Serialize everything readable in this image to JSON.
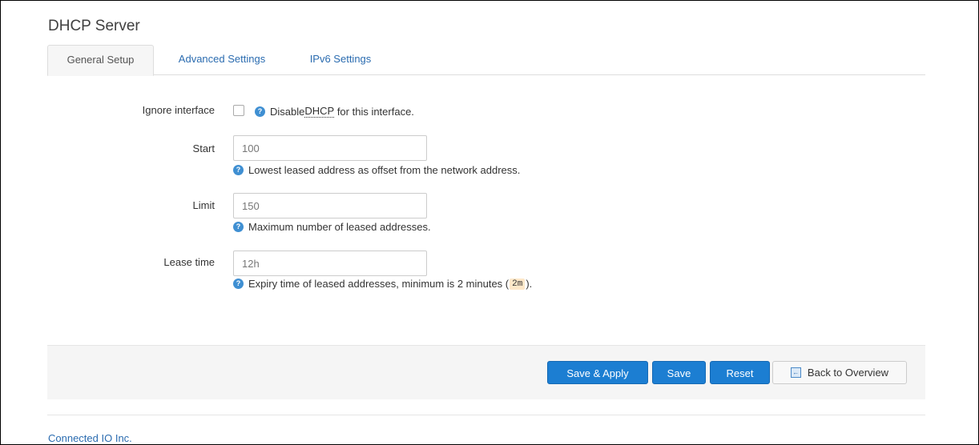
{
  "section": {
    "title": "DHCP Server"
  },
  "tabs": [
    {
      "label": "General Setup",
      "active": true
    },
    {
      "label": "Advanced Settings",
      "active": false
    },
    {
      "label": "IPv6 Settings",
      "active": false
    }
  ],
  "fields": {
    "ignore": {
      "label": "Ignore interface",
      "checked": false,
      "help_before": "Disable ",
      "help_abbr": "DHCP",
      "help_after": " for this interface."
    },
    "start": {
      "label": "Start",
      "value": "100",
      "help": "Lowest leased address as offset from the network address."
    },
    "limit": {
      "label": "Limit",
      "value": "150",
      "help": "Maximum number of leased addresses."
    },
    "lease": {
      "label": "Lease time",
      "value": "12h",
      "help_before": "Expiry time of leased addresses, minimum is 2 minutes (",
      "help_code": "2m",
      "help_after": ")."
    }
  },
  "icons": {
    "help": "help-circle-icon",
    "back": "back-arrow-icon"
  },
  "actions": {
    "save_apply": "Save & Apply",
    "save": "Save",
    "reset": "Reset",
    "back": "Back to Overview"
  },
  "footer": {
    "text": "Connected IO Inc."
  },
  "colors": {
    "primary": "#1c7ed2",
    "link": "#2b6cb0",
    "help_icon": "#3f8fd2"
  }
}
